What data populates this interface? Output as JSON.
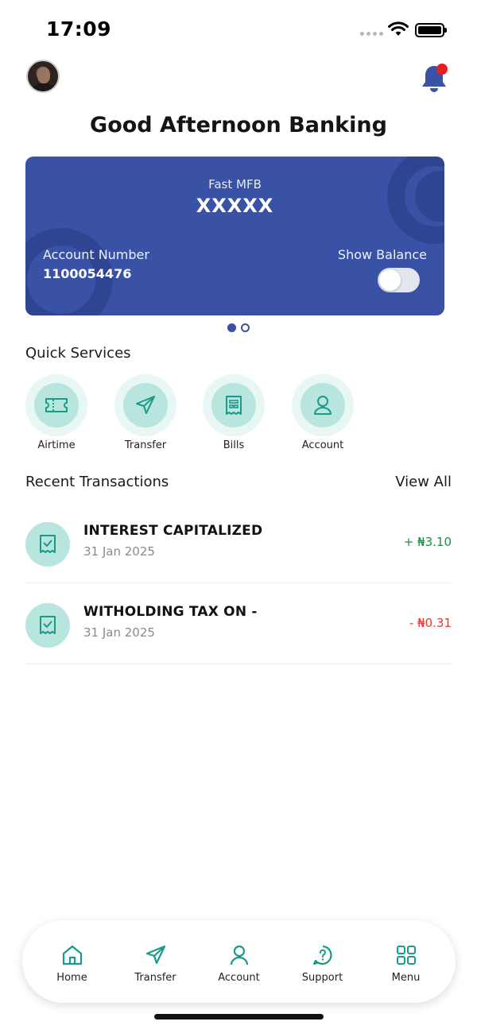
{
  "status_bar": {
    "time": "17:09"
  },
  "header": {
    "title": "Good Afternoon Banking",
    "notification_badge_color": "#ee1c1c",
    "bell_color": "#3a52a6"
  },
  "account_card": {
    "bank_name": "Fast MFB",
    "account_name": "XXXXX",
    "account_number_label": "Account Number",
    "account_number": "1100054476",
    "show_balance_label": "Show Balance",
    "show_balance_on": false,
    "card_color": "#3a52a6",
    "pager": {
      "total": 2,
      "active": 1
    }
  },
  "quick_services": {
    "title": "Quick Services",
    "items": [
      {
        "label": "Airtime",
        "icon": "ticket-icon"
      },
      {
        "label": "Transfer",
        "icon": "send-icon"
      },
      {
        "label": "Bills",
        "icon": "receipt-icon"
      },
      {
        "label": "Account",
        "icon": "user-icon"
      }
    ]
  },
  "recent_transactions": {
    "title": "Recent Transactions",
    "view_all": "View All",
    "items": [
      {
        "title": "INTEREST CAPITALIZED",
        "date": "31 Jan 2025",
        "amount": "+ ₦3.10",
        "type": "credit"
      },
      {
        "title": "WITHOLDING TAX ON -",
        "date": "31 Jan 2025",
        "amount": "- ₦0.31",
        "type": "debit"
      }
    ]
  },
  "bottom_nav": {
    "items": [
      {
        "label": "Home",
        "icon": "home-icon"
      },
      {
        "label": "Transfer",
        "icon": "send-icon"
      },
      {
        "label": "Account",
        "icon": "user-icon"
      },
      {
        "label": "Support",
        "icon": "help-icon"
      },
      {
        "label": "Menu",
        "icon": "grid-icon"
      }
    ]
  },
  "colors": {
    "accent_teal": "#1a9a8a",
    "service_bg": "#b8e6de",
    "credit": "#1e8c47",
    "debit": "#e53935"
  }
}
